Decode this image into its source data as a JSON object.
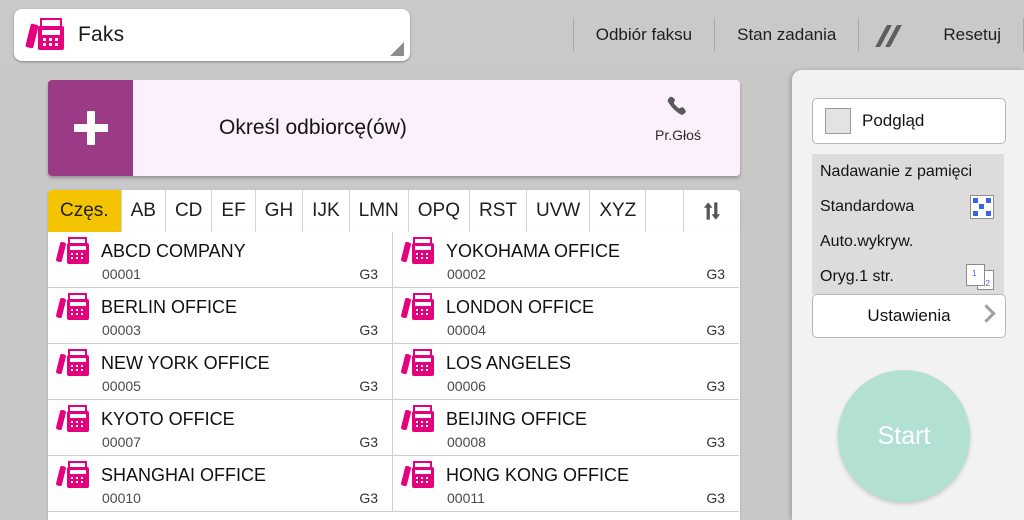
{
  "header": {
    "app_title": "Faks",
    "app_icon": "fax-icon",
    "expand_icon": "expand-corner-icon",
    "actions": [
      {
        "label": "Odbiór faksu",
        "name": "fax-reception-button"
      },
      {
        "label": "Stan zadania",
        "name": "job-status-button"
      }
    ],
    "slash_icon": "double-slash-icon",
    "reset_label": "Resetuj"
  },
  "recipient": {
    "add_icon": "plus-icon",
    "label": "Określ odbiorcę(ów)",
    "voice_icon": "phone-handset-icon",
    "voice_label": "Pr.Głoś"
  },
  "tabs": {
    "items": [
      "Częs.",
      "AB",
      "CD",
      "EF",
      "GH",
      "IJK",
      "LMN",
      "OPQ",
      "RST",
      "UVW",
      "XYZ"
    ],
    "active_index": 0,
    "sort_icon": "sort-swap-icon"
  },
  "contacts": {
    "type_label": "G3",
    "items": [
      {
        "name": "ABCD COMPANY",
        "id": "00001",
        "type": "G3"
      },
      {
        "name": "YOKOHAMA OFFICE",
        "id": "00002",
        "type": "G3"
      },
      {
        "name": "BERLIN OFFICE",
        "id": "00003",
        "type": "G3"
      },
      {
        "name": "LONDON OFFICE",
        "id": "00004",
        "type": "G3"
      },
      {
        "name": "NEW YORK OFFICE",
        "id": "00005",
        "type": "G3"
      },
      {
        "name": "LOS ANGELES",
        "id": "00006",
        "type": "G3"
      },
      {
        "name": "KYOTO OFFICE",
        "id": "00007",
        "type": "G3"
      },
      {
        "name": "BEIJING OFFICE",
        "id": "00008",
        "type": "G3"
      },
      {
        "name": "SHANGHAI  OFFICE",
        "id": "00010",
        "type": "G3"
      },
      {
        "name": "HONG KONG OFFICE",
        "id": "00011",
        "type": "G3"
      }
    ]
  },
  "sidebar": {
    "preview_label": "Podgląd",
    "preview_checked": false,
    "settings_rows": [
      {
        "label": "Nadawanie z pamięci",
        "icon": ""
      },
      {
        "label": "Standardowa",
        "icon": "resolution-icon"
      },
      {
        "label": "Auto.wykryw.",
        "icon": ""
      },
      {
        "label": "Oryg.1 str.",
        "icon": "original-sides-icon"
      }
    ],
    "pages_icon_front": "1",
    "pages_icon_back": "2",
    "settings_button_label": "Ustawienia",
    "settings_chevron": "chevron-right-icon",
    "start_label": "Start"
  },
  "colors": {
    "magenta": "#9b3b87",
    "pink_bg": "#fbf0fb",
    "fax_pink": "#e5007e",
    "tab_active": "#f5c400",
    "start_green": "#b2e0d2",
    "page_bg": "#c8c8c8"
  }
}
